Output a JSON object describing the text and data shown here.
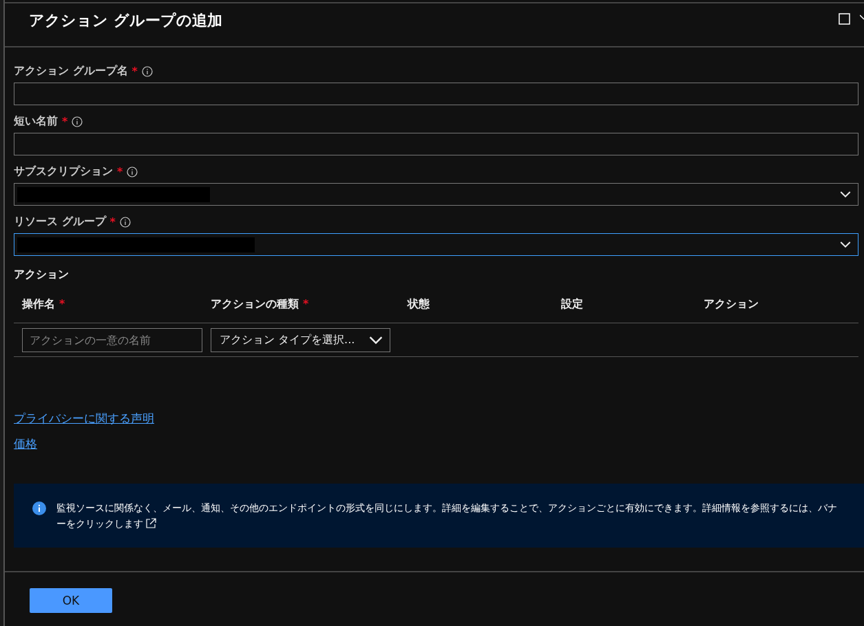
{
  "panel": {
    "title": "アクション グループの追加"
  },
  "fields": [
    {
      "label": "アクション グループ名",
      "required_mark": "*",
      "kind": "text",
      "focused": false
    },
    {
      "label": "短い名前",
      "required_mark": "*",
      "kind": "text",
      "focused": false
    },
    {
      "label": "サブスクリプション",
      "required_mark": "*",
      "kind": "select",
      "focused": false
    },
    {
      "label": "リソース グループ",
      "required_mark": "*",
      "kind": "select",
      "focused": true
    }
  ],
  "actions": {
    "heading": "アクション",
    "columns": [
      {
        "label": "操作名",
        "required_mark": "*"
      },
      {
        "label": "アクションの種類",
        "required_mark": "*"
      },
      {
        "label": "状態"
      },
      {
        "label": "設定"
      },
      {
        "label": "アクション"
      }
    ],
    "row": {
      "name_placeholder": "アクションの一意の名前",
      "type_select": "アクション タイプを選択..."
    }
  },
  "links": [
    "プライバシーに関する声明",
    "価格"
  ],
  "banner": {
    "text": "監視ソースに関係なく、メール、通知、その他のエンドポイントの形式を同じにします。詳細を編集することで、アクションごとに有効にできます。詳細情報を参照するには、バナーをクリックします"
  },
  "buttons": [
    {
      "label": "OK"
    }
  ]
}
